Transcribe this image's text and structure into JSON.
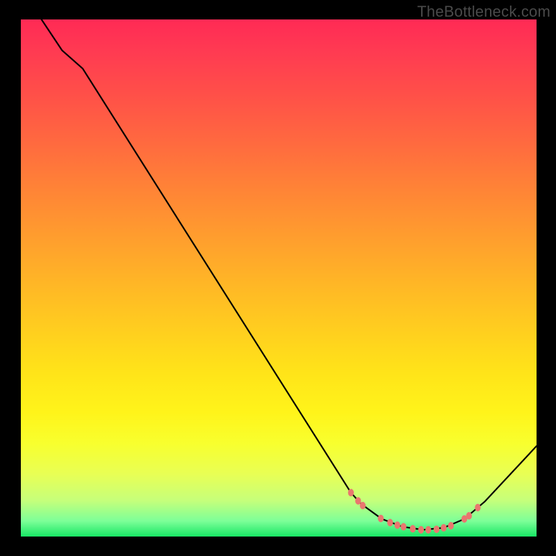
{
  "watermark": "TheBottleneck.com",
  "colors": {
    "frame_bg": "#000000",
    "marker": "#e9776f",
    "curve": "#000000",
    "gradient_top": "#ff2a55",
    "gradient_bottom": "#18e765"
  },
  "chart_data": {
    "type": "line",
    "title": "",
    "xlabel": "",
    "ylabel": "",
    "xlim": [
      0,
      100
    ],
    "ylim": [
      0,
      100
    ],
    "curve": [
      {
        "x": 4,
        "y": 100
      },
      {
        "x": 8,
        "y": 94
      },
      {
        "x": 12,
        "y": 90.5
      },
      {
        "x": 64,
        "y": 8.5
      },
      {
        "x": 66,
        "y": 6.3
      },
      {
        "x": 70,
        "y": 3.4
      },
      {
        "x": 74,
        "y": 1.9
      },
      {
        "x": 78,
        "y": 1.3
      },
      {
        "x": 82,
        "y": 1.7
      },
      {
        "x": 86,
        "y": 3.4
      },
      {
        "x": 90,
        "y": 6.8
      },
      {
        "x": 100,
        "y": 17.5
      }
    ],
    "markers": [
      {
        "x": 64.0,
        "y": 8.5
      },
      {
        "x": 65.4,
        "y": 6.9
      },
      {
        "x": 66.3,
        "y": 6.0
      },
      {
        "x": 69.8,
        "y": 3.5
      },
      {
        "x": 71.6,
        "y": 2.7
      },
      {
        "x": 73.0,
        "y": 2.2
      },
      {
        "x": 74.2,
        "y": 1.9
      },
      {
        "x": 76.0,
        "y": 1.5
      },
      {
        "x": 77.6,
        "y": 1.3
      },
      {
        "x": 79.0,
        "y": 1.3
      },
      {
        "x": 80.6,
        "y": 1.4
      },
      {
        "x": 82.0,
        "y": 1.7
      },
      {
        "x": 83.4,
        "y": 2.1
      },
      {
        "x": 86.0,
        "y": 3.4
      },
      {
        "x": 86.9,
        "y": 4.0
      },
      {
        "x": 88.6,
        "y": 5.6
      }
    ]
  }
}
